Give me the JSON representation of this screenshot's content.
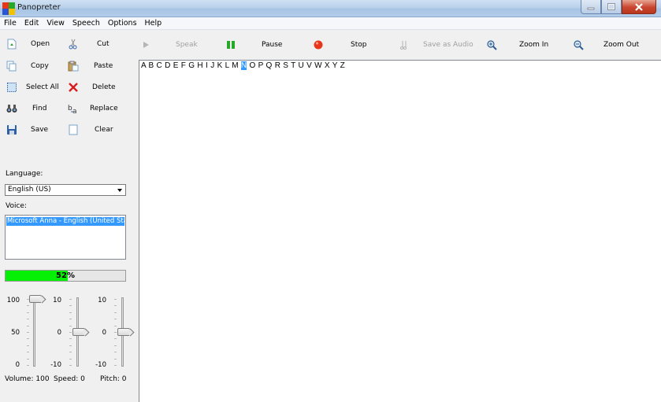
{
  "window": {
    "title": "Panopreter"
  },
  "menu": [
    "File",
    "Edit",
    "View",
    "Speech",
    "Options",
    "Help"
  ],
  "toolbar": {
    "speak": "Speak",
    "pause": "Pause",
    "stop": "Stop",
    "save_audio": "Save as Audio",
    "zoom_in": "Zoom In",
    "zoom_out": "Zoom Out"
  },
  "edit_buttons": {
    "open": "Open",
    "cut": "Cut",
    "copy": "Copy",
    "paste": "Paste",
    "select_all": "Select All",
    "delete": "Delete",
    "find": "Find",
    "replace": "Replace",
    "save": "Save",
    "clear": "Clear"
  },
  "language": {
    "label": "Language:",
    "selected": "English (US)"
  },
  "voice": {
    "label": "Voice:",
    "selected": "Microsoft Anna - English (United States)"
  },
  "progress": {
    "text": "52%",
    "value": 52
  },
  "sliders": {
    "volume": {
      "max": "100",
      "mid": "50",
      "min": "0",
      "value": 100,
      "label": "Volume: 100"
    },
    "speed": {
      "max": "10",
      "mid": "0",
      "min": "-10",
      "value": 0,
      "label": "Speed: 0"
    },
    "pitch": {
      "max": "10",
      "mid": "0",
      "min": "-10",
      "value": 0,
      "label": "Pitch: 0"
    }
  },
  "document": {
    "text_before": "A B C D E F G H I J K L M ",
    "highlighted": "N",
    "text_after": " O P Q R S T U V W X Y Z"
  },
  "colors": {
    "progress_fill": "#06f006",
    "selection": "#3399ff",
    "stop_red": "#e8361b",
    "pause_green": "#28a828"
  }
}
